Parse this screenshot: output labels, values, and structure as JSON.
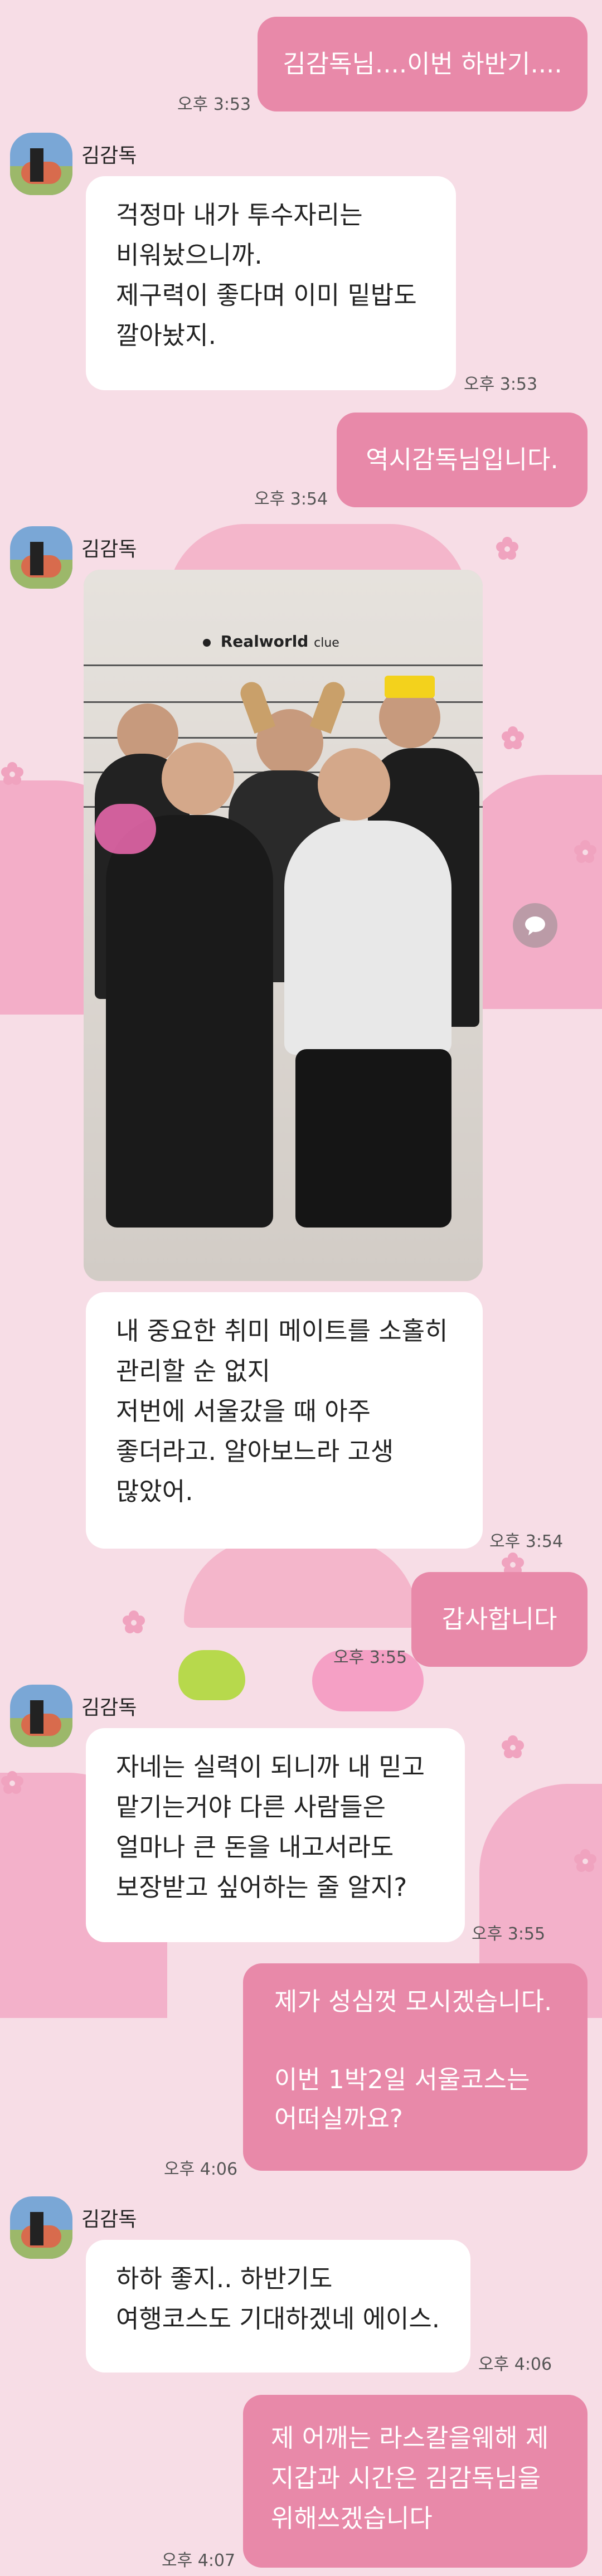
{
  "messages": [
    {
      "id": "m1",
      "dir": "out",
      "text": "김감독님....이번 하반기....",
      "time": "오후 3:53"
    },
    {
      "id": "m2",
      "dir": "in",
      "sender": "김감독",
      "text": "걱정마 내가 투수자리는\n비워놨으니까.\n제구력이 좋다며 이미 밑밥도\n깔아놨지.",
      "time": "오후 3:53"
    },
    {
      "id": "m3",
      "dir": "out",
      "text": "역시감독님입니다.",
      "time": "오후 3:54"
    },
    {
      "id": "m4",
      "dir": "in",
      "sender": "김감독",
      "photo": {
        "brand": "Realworld",
        "brand_sub": "clue"
      },
      "text": "내 중요한 취미 메이트를 소홀히\n관리할 순 없지\n저번에 서울갔을 때 아주\n좋더라고. 알아보느라 고생\n많았어.",
      "time": "오후 3:54"
    },
    {
      "id": "m5",
      "dir": "out",
      "text": "갑사합니다",
      "time": "오후 3:55"
    },
    {
      "id": "m6",
      "dir": "in",
      "sender": "김감독",
      "text": "자네는 실력이 되니까 내 믿고\n맡기는거야 다른 사람들은\n얼마나 큰 돈을 내고서라도\n보장받고 싶어하는 줄 알지?",
      "time": "오후 3:55"
    },
    {
      "id": "m7",
      "dir": "out",
      "text": "제가 성심껏 모시겠습니다.\n\n이번 1박2일 서울코스는\n어떠실까요?",
      "time": "오후 4:06"
    },
    {
      "id": "m8",
      "dir": "in",
      "sender": "김감독",
      "text": "하하 좋지.. 하반기도\n여행코스도 기대하겠네 에이스.",
      "time": "오후 4:06"
    },
    {
      "id": "m9",
      "dir": "out",
      "text": "제 어깨는 라스칼을웨해 제\n지갑과 시간은 김감독님을\n위해쓰겠습니다",
      "time": "오후 4:07"
    }
  ],
  "icons": {
    "share": "share-icon"
  },
  "colors": {
    "background": "#f7dde6",
    "outgoing": "#e889a9",
    "incoming": "#ffffff",
    "decor": "#f2a9c4"
  }
}
